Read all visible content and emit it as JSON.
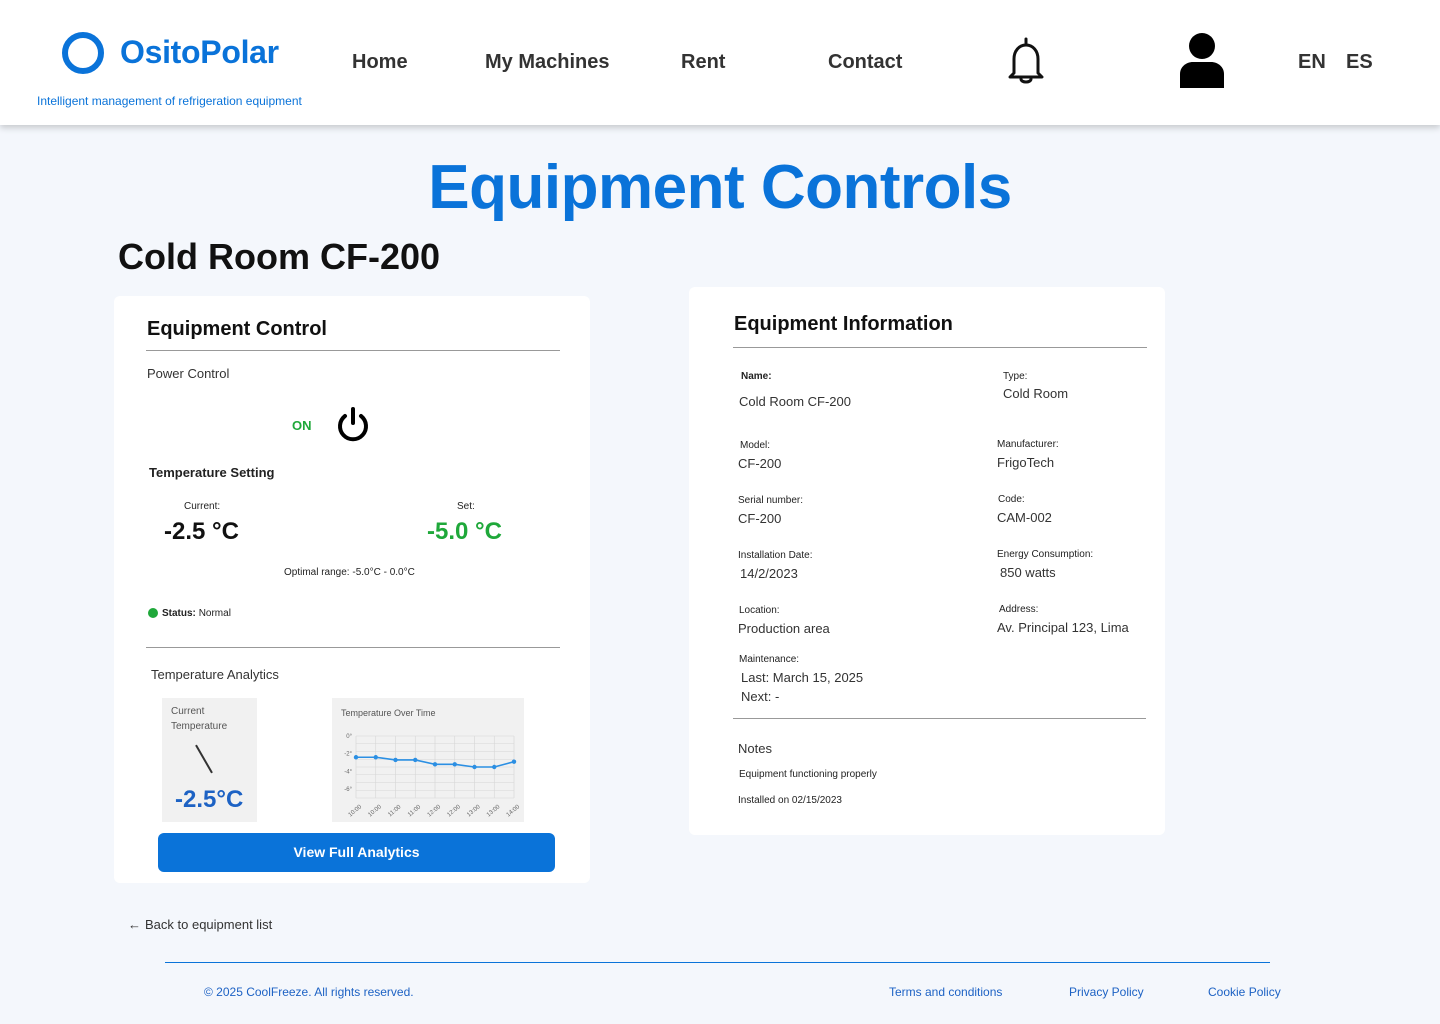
{
  "brand": {
    "name": "OsitoPolar",
    "tagline": "Intelligent management of refrigeration equipment"
  },
  "nav": {
    "home": "Home",
    "machines": "My Machines",
    "rent": "Rent",
    "contact": "Contact"
  },
  "languages": {
    "en": "EN",
    "es": "ES"
  },
  "icons": {
    "bell": "bell-icon",
    "user": "user-icon",
    "power": "power-icon",
    "back": "arrow-left-icon"
  },
  "colors": {
    "accent": "#0a73d9",
    "ok": "#1fa83a",
    "background": "#f4f7fc"
  },
  "page": {
    "title": "Equipment Controls",
    "equipment_name": "Cold Room CF-200"
  },
  "control": {
    "title": "Equipment Control",
    "power_label": "Power Control",
    "power_state": "ON",
    "temp_setting": "Temperature Setting",
    "current_label": "Current:",
    "current_value": "-2.5 °C",
    "set_label": "Set:",
    "set_value": "-5.0 °C",
    "optimal_range": "Optimal range: -5.0°C - 0.0°C",
    "status_label": "Status:",
    "status_value": "Normal",
    "analytics_title": "Temperature Analytics",
    "gauge_caption": "Current Temperature",
    "gauge_value": "-2.5°C",
    "chart_caption": "Temperature Over Time",
    "analytics_button": "View Full Analytics"
  },
  "chart_data": {
    "type": "line",
    "title": "Temperature Over Time",
    "x": [
      "10:00",
      "10:00",
      "11:00",
      "11:00",
      "12:00",
      "12:00",
      "13:00",
      "13:00",
      "14:00"
    ],
    "y_ticks": [
      "0°",
      "-2°",
      "-4°",
      "-6°"
    ],
    "ylim": [
      -7,
      0
    ],
    "series": [
      {
        "values": [
          -2.4,
          -2.4,
          -2.7,
          -2.7,
          -3.2,
          -3.2,
          -3.5,
          -3.5,
          -2.9
        ]
      }
    ],
    "grid": true
  },
  "info": {
    "title": "Equipment Information",
    "name_label": "Name:",
    "name_value": "Cold Room CF-200",
    "type_label": "Type:",
    "type_value": "Cold Room",
    "model_label": "Model:",
    "model_value": "CF-200",
    "manufacturer_label": "Manufacturer:",
    "manufacturer_value": "FrigoTech",
    "serial_label": "Serial number:",
    "serial_value": "CF-200",
    "code_label": "Code:",
    "code_value": "CAM-002",
    "install_label": "Installation Date:",
    "install_value": "14/2/2023",
    "energy_label": "Energy Consumption:",
    "energy_value": "850 watts",
    "location_label": "Location:",
    "location_value": "Production area",
    "address_label": "Address:",
    "address_value": "Av. Principal 123, Lima",
    "maintenance_label": "Maintenance:",
    "maintenance_last": "Last: March 15, 2025",
    "maintenance_next": "Next: -",
    "notes_label": "Notes",
    "note_1": "Equipment functioning properly",
    "note_2": "Installed on 02/15/2023"
  },
  "back_link": "Back to equipment list",
  "footer": {
    "copyright": "© 2025 CoolFreeze. All rights reserved.",
    "terms": "Terms and conditions",
    "privacy": "Privacy Policy",
    "cookie": "Cookie Policy"
  }
}
